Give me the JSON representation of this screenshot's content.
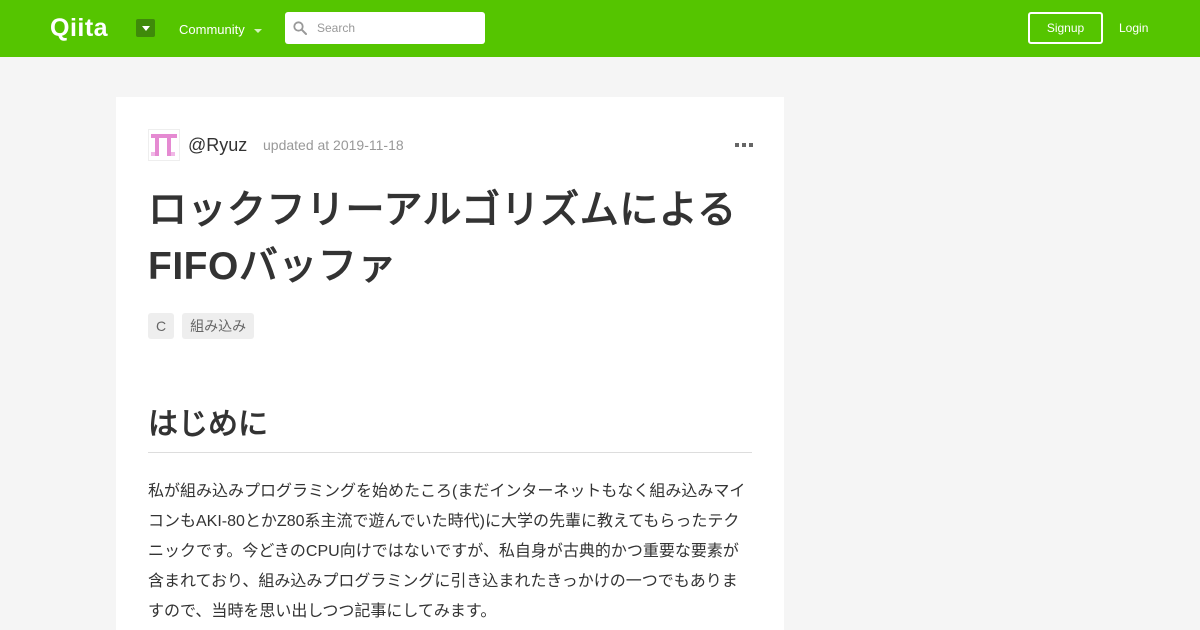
{
  "header": {
    "logo": "Qiita",
    "community_label": "Community",
    "search_placeholder": "Search",
    "signup_label": "Signup",
    "login_label": "Login"
  },
  "article": {
    "author": "@Ryuz",
    "updated": "updated at 2019-11-18",
    "title": "ロックフリーアルゴリズムによるFIFOバッファ",
    "tags": [
      "C",
      "組み込み"
    ],
    "heading": "はじめに",
    "paragraph": "私が組み込みプログラミングを始めたころ(まだインターネットもなく組み込みマイコンもAKI-80とかZ80系主流で遊んでいた時代)に大学の先輩に教えてもらったテクニックです。今どきのCPU向けではないですが、私自身が古典的かつ重要な要素が含まれており、組み込みプログラミングに引き込まれたきっかけの一つでもありますので、当時を思い出しつつ記事にしてみます。"
  },
  "colors": {
    "brand": "#55c500",
    "page_bg": "#f5f5f5",
    "avatar_accent": "#e58ad2"
  }
}
